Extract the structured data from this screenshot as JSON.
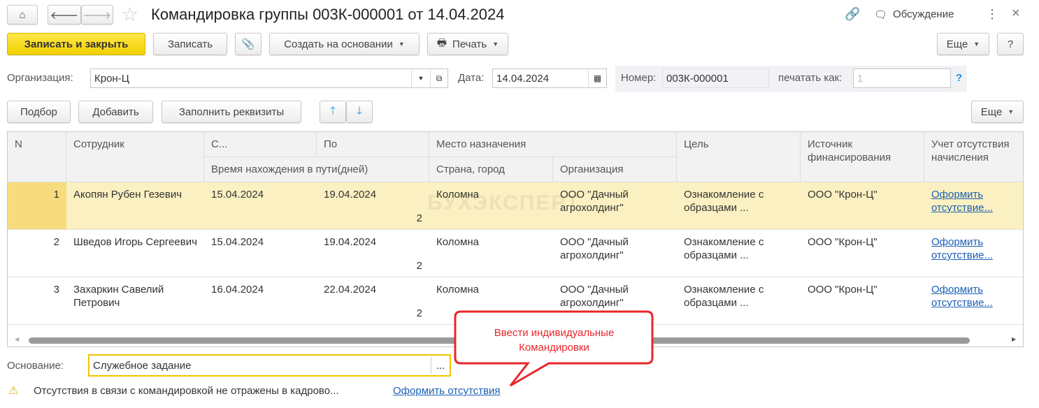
{
  "title": "Командировка группы 003К-000001 от 14.04.2024",
  "header_right": {
    "discussion": "Обсуждение"
  },
  "toolbar": {
    "save_close": "Записать и закрыть",
    "save": "Записать",
    "create_based": "Создать на основании",
    "print": "Печать",
    "more": "Еще",
    "help": "?"
  },
  "form": {
    "org_label": "Организация:",
    "org_value": "Крон-Ц",
    "date_label": "Дата:",
    "date_value": "14.04.2024",
    "number_label": "Номер:",
    "number_value": "003К-000001",
    "print_as_label": "печатать как:",
    "print_as_value": "1",
    "print_as_help": "?"
  },
  "table_toolbar": {
    "pick": "Подбор",
    "add": "Добавить",
    "fill": "Заполнить реквизиты",
    "more": "Еще"
  },
  "columns": {
    "n": "N",
    "employee": "Сотрудник",
    "from": "С...",
    "to": "По",
    "travel_days": "Время нахождения в пути(дней)",
    "destination": "Место назначения",
    "city": "Страна, город",
    "org": "Организация",
    "purpose": "Цель",
    "funding": "Источник финансирования",
    "absence": "Учет отсутствия начисления"
  },
  "rows": [
    {
      "n": "1",
      "employee": "Акопян Рубен Гезевич",
      "from": "15.04.2024",
      "to": "19.04.2024",
      "days": "2",
      "city": "Коломна",
      "org": "ООО \"Дачный агрохолдинг\"",
      "purpose": "Ознакомление с образцами ...",
      "funding": "ООО \"Крон-Ц\"",
      "absence": "Оформить отсутствие..."
    },
    {
      "n": "2",
      "employee": "Шведов Игорь Сергеевич",
      "from": "15.04.2024",
      "to": "19.04.2024",
      "days": "2",
      "city": "Коломна",
      "org": "ООО \"Дачный агрохолдинг\"",
      "purpose": "Ознакомление с образцами ...",
      "funding": "ООО \"Крон-Ц\"",
      "absence": "Оформить отсутствие..."
    },
    {
      "n": "3",
      "employee": "Захаркин Савелий Петрович",
      "from": "16.04.2024",
      "to": "22.04.2024",
      "days": "2",
      "city": "Коломна",
      "org": "ООО \"Дачный агрохолдинг\"",
      "purpose": "Ознакомление с образцами ...",
      "funding": "ООО \"Крон-Ц\"",
      "absence": "Оформить отсутствие..."
    }
  ],
  "watermark": "БУХЭКСПЕРТ",
  "basis": {
    "label": "Основание:",
    "value": "Служебное задание",
    "button": "..."
  },
  "warning": {
    "text": "Отсутствия в связи с командировкой не отражены в кадрово...",
    "link": "Оформить отсутствия"
  },
  "callout": {
    "text": "Ввести индивидуальные Командировки",
    "color": "#e8262b"
  }
}
